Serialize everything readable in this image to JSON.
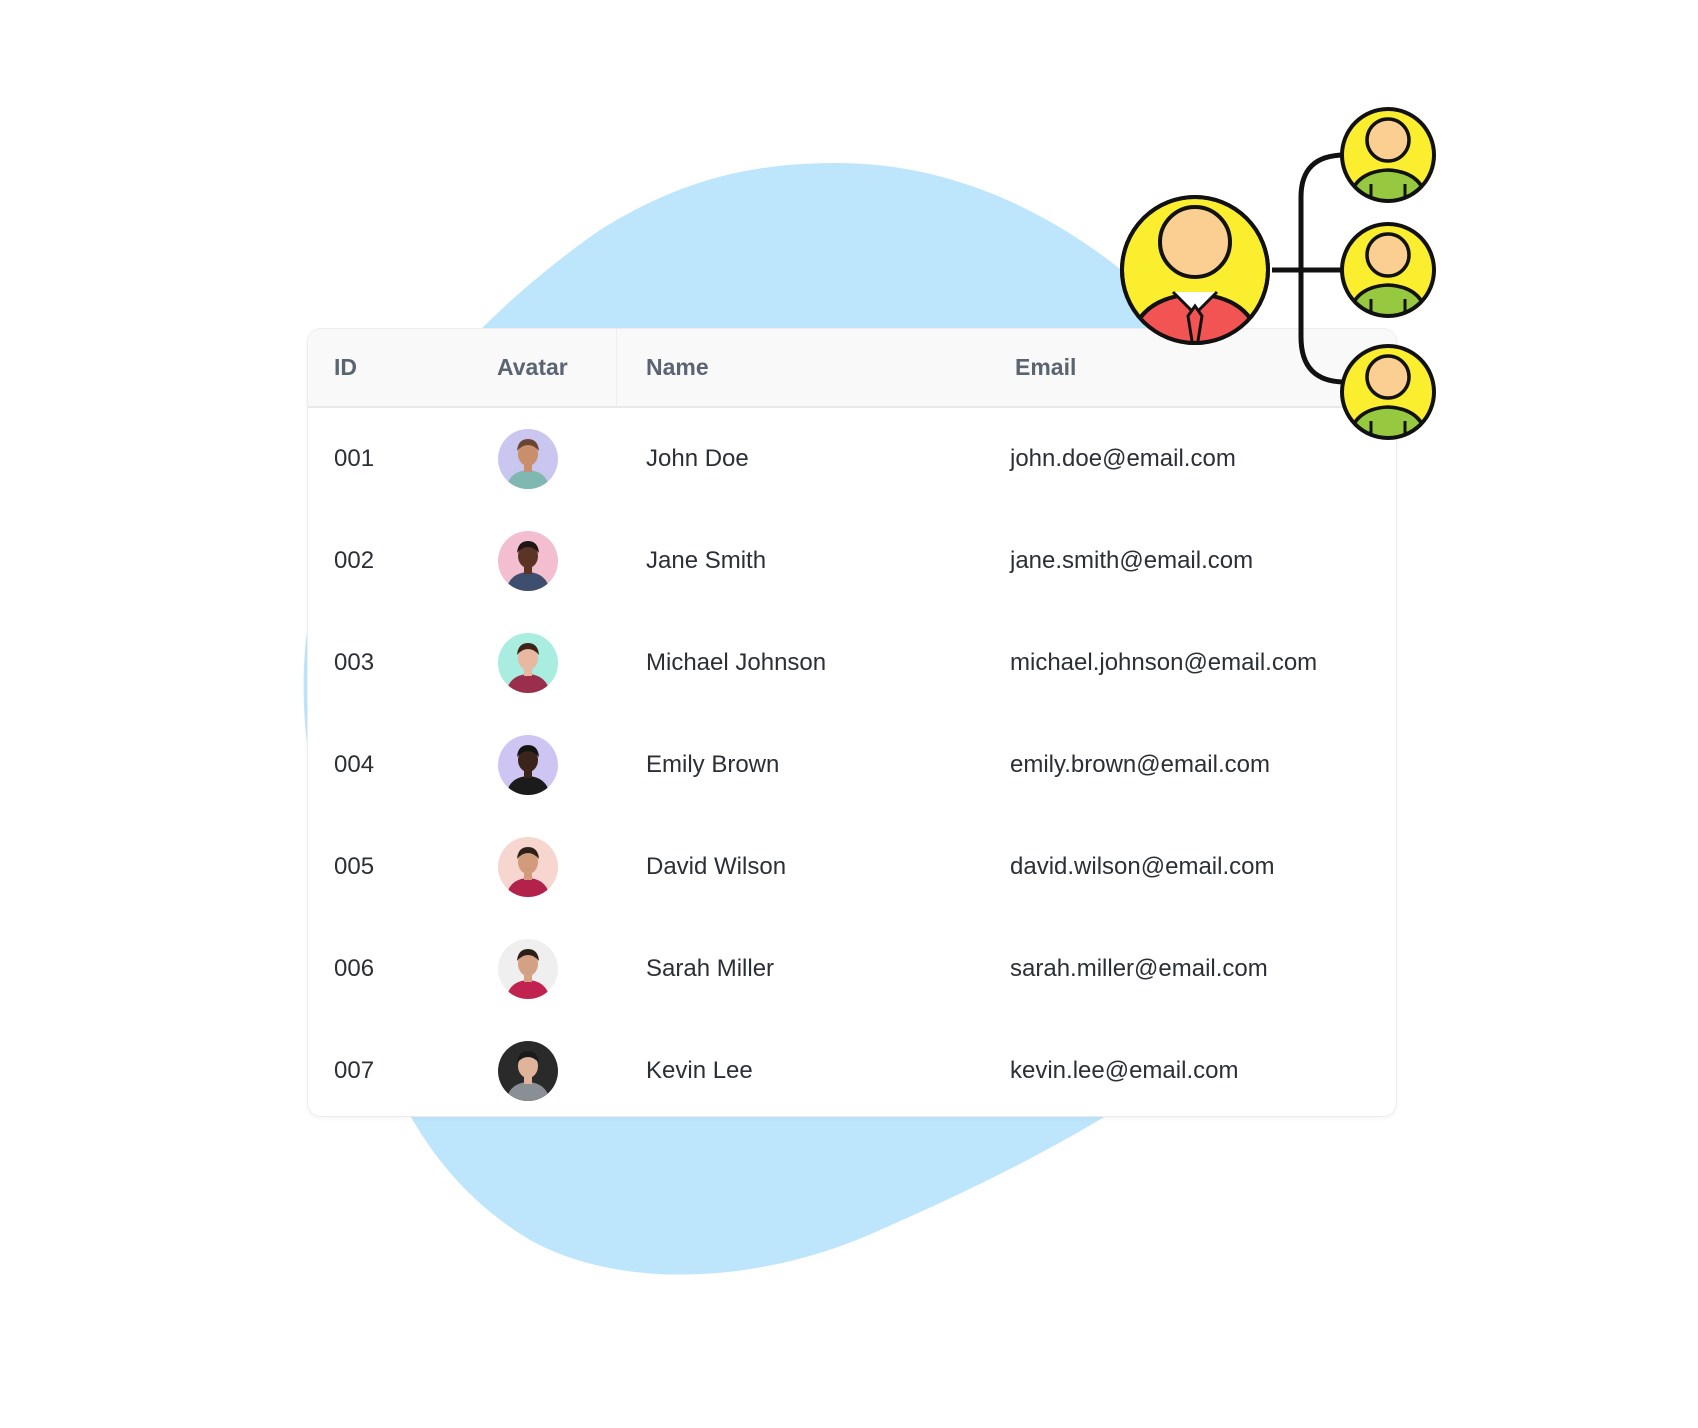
{
  "table": {
    "headers": {
      "id": "ID",
      "avatar": "Avatar",
      "name": "Name",
      "email": "Email"
    },
    "rows": [
      {
        "id": "001",
        "name": "John Doe",
        "email": "john.doe@email.com",
        "avatar_bg": "#c9c6f0",
        "skin": "#c98e6b",
        "hair": "#6a4632",
        "shirt": "#7fb8b0"
      },
      {
        "id": "002",
        "name": "Jane Smith",
        "email": "jane.smith@email.com",
        "avatar_bg": "#f3bfd0",
        "skin": "#5a3525",
        "hair": "#1f1512",
        "shirt": "#3e4e6e"
      },
      {
        "id": "003",
        "name": "Michael Johnson",
        "email": "michael.johnson@email.com",
        "avatar_bg": "#a9ece0",
        "skin": "#e8b9a0",
        "hair": "#3d2418",
        "shirt": "#9b2e4a"
      },
      {
        "id": "004",
        "name": "Emily Brown",
        "email": "emily.brown@email.com",
        "avatar_bg": "#cfc5f2",
        "skin": "#3b2419",
        "hair": "#141414",
        "shirt": "#1b1b1b"
      },
      {
        "id": "005",
        "name": "David Wilson",
        "email": "david.wilson@email.com",
        "avatar_bg": "#f6d6cf",
        "skin": "#d19b7c",
        "hair": "#2f2019",
        "shirt": "#b3224a"
      },
      {
        "id": "006",
        "name": "Sarah Miller",
        "email": "sarah.miller@email.com",
        "avatar_bg": "#efefef",
        "skin": "#d4a184",
        "hair": "#2d1f18",
        "shirt": "#c0234f"
      },
      {
        "id": "007",
        "name": "Kevin Lee",
        "email": "kevin.lee@email.com",
        "avatar_bg": "#2a2a2a",
        "skin": "#e0b49a",
        "hair": "#1a1a1a",
        "shirt": "#8a8f96"
      }
    ]
  },
  "colors": {
    "blob": "#bde6fc",
    "org_yellow": "#fbee2f",
    "org_face": "#fbcf91",
    "org_leader_shirt": "#f25454",
    "org_member_shirt": "#96c93f"
  },
  "icons": {
    "org_chart": "org-chart-icon"
  }
}
